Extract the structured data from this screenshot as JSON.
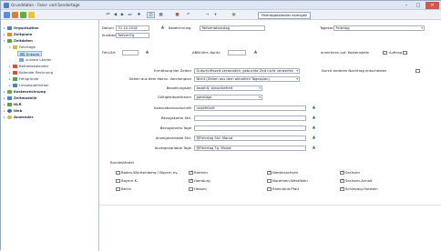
{
  "window": {
    "title": "Grunddaten - Feier- und Sondertage",
    "min": "–",
    "max": "□",
    "close": "✕"
  },
  "toolbar": {
    "feiertag_button": "Feiertagskalender erzeugen"
  },
  "tree": {
    "organisation": "Organisation",
    "zeitplane": "Zeitplane",
    "zeitdaten": "Zeitdaten",
    "feiertage": "Feiertage",
    "entsam": "Entsam",
    "unklare_lander": "unklare Länder",
    "betriebskalender": "Betriebskalender",
    "kalender_rechnung": "Kalender Rechnung",
    "fahrgruende": "Fehlgründe",
    "urlaubsdefinition": "Urlaubsdefinition",
    "kostenrechnung": "Kostenrechnung",
    "zeitmodelle": "Zeitmodelle",
    "nlr": "NLR",
    "web": "Web",
    "anwender": "Anwender"
  },
  "form": {
    "datum_label": "Datum",
    "datum_value": "31.10.2018",
    "bezeichnung_label": "Bezeichnung",
    "bezeichnung_value": "Reformationstag",
    "tagesart_label": "Tagesart",
    "tagesart_value": "Feiertag",
    "kurzbez_label": "Kurzbez.",
    "kurzbez_value": "ReformTg",
    "fehlart_label": "Fehl-Art",
    "abw_label": "ABW-Verr.-Konto",
    "anrechnen_label": "anrechnen auf: Kostenstelle",
    "auftrag_label": "Auftrag",
    "ermittlung_label": "Ermittlung der Zeiten",
    "ermittlung_value": "Gutschriftszeit verwenden, gebuchte Zeit nicht verwerfen",
    "durch_label": "Durch anderen Nachtrag entscheiden",
    "zeiten_label": "Zeiten aus dem ebenz. Vorchenplan",
    "zeiten_value": "Nicht (Zeiten aus dem aktuellen Tagesplan)",
    "bezahlungsart_label": "Bezahlungsart",
    "bezahlungsart_value": "bezahlt, steuerbefreit",
    "gueltigkeit_label": "Gültigkeitszeitraum",
    "gueltigkeit_value": "ganztags",
    "kalkulation_label": "Kalkulationsvorschrift",
    "kalkulation_value": "undefiniert",
    "bezugskonto_std_label": "Bezugskonto Std.",
    "bezugskonto_tage_label": "Bezugskonto Tage",
    "anzeige_std_label": "Anzeigevariable Std.",
    "anzeige_std_value": "@Feiertag Std. Monat",
    "anzeige_tage_label": "Anzeigevariable Tage",
    "anzeige_tage_value": "@Feiertag Tg. Monat",
    "bundeslaender_label": "Bundesländer"
  },
  "states": [
    {
      "name": "Baden-Württemberg / Bayern ev.",
      "checked": false
    },
    {
      "name": "Bremen",
      "checked": true
    },
    {
      "name": "Niedersachsen",
      "checked": true
    },
    {
      "name": "Sachsen",
      "checked": true
    },
    {
      "name": "Bayern K.",
      "checked": false
    },
    {
      "name": "Hamburg",
      "checked": true
    },
    {
      "name": "Nordrhein-Westfalen",
      "checked": false
    },
    {
      "name": "Sachsen-Anhalt",
      "checked": true
    },
    {
      "name": "Berlin",
      "checked": false
    },
    {
      "name": "Hessen",
      "checked": false
    },
    {
      "name": "Rheinland-Pfalz",
      "checked": false
    },
    {
      "name": "Schleswig-Holstein",
      "checked": true
    }
  ]
}
